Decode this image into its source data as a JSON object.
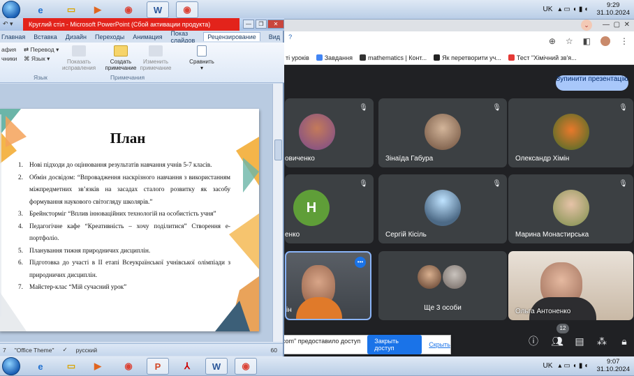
{
  "taskbar_top": {
    "lang": "UK",
    "time": "9:29",
    "date": "31.10.2024"
  },
  "taskbar_bottom": {
    "lang": "UK",
    "time": "9:07",
    "date": "31.10.2024"
  },
  "powerpoint": {
    "title": "Круглий стіл - Microsoft PowerPoint (Сбой активации продукта)",
    "tabs": [
      "Главная",
      "Вставка",
      "Дизайн",
      "Переходы",
      "Анимация",
      "Показ слайдов",
      "Рецензирование",
      "Вид"
    ],
    "selected_tab": "Рецензирование",
    "ribbon": {
      "left_items": [
        "афия",
        "чники"
      ],
      "translate": "Перевод",
      "language": "Язык",
      "group_language": "Язык",
      "show_changes": "Показать исправления",
      "create_note": "Создать примечание",
      "edit_note": "Изменить примечание",
      "group_notes": "Примечания",
      "compare": "Сравнить"
    },
    "slide": {
      "title": "План",
      "items": [
        {
          "num": "1.",
          "text": "Нові підходи до оцінювання результатів навчання учнів 5-7 класів."
        },
        {
          "num": "2.",
          "text": "Обмін досвідом: “Впровадження наскрізного навчання з використанням міжпредметних зв’язків на засадах сталого розвитку як засобу формування наукового світогляду школярів.”"
        },
        {
          "num": "3.",
          "text": "Брейнсторміг “Вплив інноваційних технологій на особистість учня”"
        },
        {
          "num": "4.",
          "text": "Педагогічне кафе “Креативність – хочу поділитися” Створення е-портфоліо."
        },
        {
          "num": "5.",
          "text": "Планування тижня природничих дисциплін."
        },
        {
          "num": "6.",
          "text": "Підготовка до участі в ІІ етапі Всеукраїнської учнівської олімпіади з природничих дисциплін."
        },
        {
          "num": "7.",
          "text": "Майстер-клас “Мій сучасний урок”"
        }
      ]
    },
    "statusbar": {
      "page": "7",
      "theme": "\"Office Theme\"",
      "language": "русский",
      "zoom": "60"
    }
  },
  "chrome": {
    "bookmarks": [
      "ті уроків",
      "Завдання",
      "mathematics | Конт...",
      "Як перетворити уч...",
      "Тест \"Хімічний зв'я..."
    ]
  },
  "meet": {
    "stop_presenting": "Зупинити презентацію",
    "tiles": [
      {
        "name": "овиченко",
        "avatar": "photo"
      },
      {
        "name": "Зінаїда Габура",
        "avatar": "photo"
      },
      {
        "name": "Олександр Хімін",
        "avatar": "photo"
      },
      {
        "name": "енко",
        "avatar": "letter",
        "letter": "Н"
      },
      {
        "name": "Сергій Кісіль",
        "avatar": "photo"
      },
      {
        "name": "Марина Монастирська",
        "avatar": "photo"
      },
      {
        "name": "ін",
        "avatar": "video"
      },
      {
        "name": "Ще 3 особи",
        "avatar": "group"
      },
      {
        "name": "Ольга Антоненко",
        "avatar": "video"
      }
    ],
    "participant_count": "12",
    "share_notice": "Приложение \"meet.google.com\" предоставило доступ к окну.",
    "share_allow": "Закрыть доступ",
    "share_hide": "Скрыть"
  },
  "colors": {
    "meet_bg": "#202124",
    "tile_bg": "#3c4043",
    "ppt_title_red": "#e3231b",
    "stop_btn": "#a8c7fa",
    "avatar_green": "#5f9e38"
  }
}
